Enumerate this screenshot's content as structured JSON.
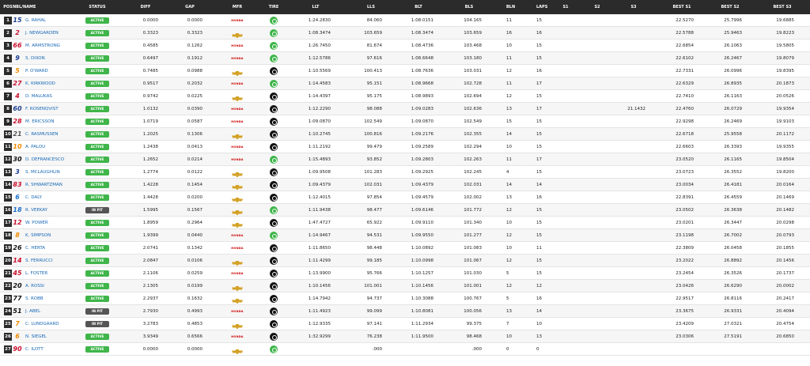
{
  "header": {
    "pos": "POS",
    "number_name": "NBL/NAME",
    "status": "STATUS",
    "diff": "DIFF",
    "gap": "GAP",
    "mfr": "MFR",
    "tire": "TIRE",
    "llt": "LLT",
    "lls": "LLS",
    "blt": "BLT",
    "bls": "BLS",
    "bln": "BLN",
    "laps": "LAPS",
    "s1": "S1",
    "s2": "S2",
    "s3": "S3",
    "best_s1": "BEST S1",
    "best_s2": "BEST S2",
    "best_s3": "BEST S3"
  },
  "colors": {
    "active": "#3fb54a",
    "in_pit": "#555555",
    "name_link": "#1769b5",
    "header_bg": "#2b2b2b"
  },
  "rows": [
    {
      "pos": "1",
      "num": "15",
      "num_color": "#1a3d8f",
      "name": "G. RAHAL",
      "status": "ACTIVE",
      "diff": "0.0000",
      "gap": "0.0000",
      "mfr": "honda",
      "tire": "green",
      "llt": "1:24.2830",
      "lls": "84.060",
      "blt": "1:08.0151",
      "bls": "104.165",
      "bln": "11",
      "laps": "15",
      "s1": "",
      "s2": "",
      "s3": "",
      "bs1": "22.5270",
      "bs2": "25.7996",
      "bs3": "19.6885"
    },
    {
      "pos": "2",
      "num": "2",
      "num_color": "#c8102e",
      "name": "J. NEWGARDEN",
      "status": "ACTIVE",
      "diff": "0.3323",
      "gap": "0.3323",
      "mfr": "chevy",
      "tire": "green",
      "llt": "1:08.3474",
      "lls": "103.659",
      "blt": "1:08.3474",
      "bls": "103.659",
      "bln": "16",
      "laps": "16",
      "s1": "",
      "s2": "",
      "s3": "",
      "bs1": "22.5788",
      "bs2": "25.9463",
      "bs3": "19.8223"
    },
    {
      "pos": "3",
      "num": "66",
      "num_color": "#c8102e",
      "name": "M. ARMSTRONG",
      "status": "ACTIVE",
      "diff": "0.4585",
      "gap": "0.1262",
      "mfr": "honda",
      "tire": "green",
      "llt": "1:26.7450",
      "lls": "81.674",
      "blt": "1:08.4736",
      "bls": "103.468",
      "bln": "10",
      "laps": "15",
      "s1": "",
      "s2": "",
      "s3": "",
      "bs1": "22.6854",
      "bs2": "26.1063",
      "bs3": "19.5805"
    },
    {
      "pos": "4",
      "num": "9",
      "num_color": "#1a3d8f",
      "name": "S. DIXON",
      "status": "ACTIVE",
      "diff": "0.6497",
      "gap": "0.1912",
      "mfr": "honda",
      "tire": "green",
      "llt": "1:12.5786",
      "lls": "97.616",
      "blt": "1:08.6648",
      "bls": "103.180",
      "bln": "11",
      "laps": "15",
      "s1": "",
      "s2": "",
      "s3": "",
      "bs1": "22.6102",
      "bs2": "26.2467",
      "bs3": "19.8079"
    },
    {
      "pos": "5",
      "num": "5",
      "num_color": "#f08a00",
      "name": "P. O'WARD",
      "status": "ACTIVE",
      "diff": "0.7485",
      "gap": "0.0988",
      "mfr": "chevy",
      "tire": "black",
      "llt": "1:10.5569",
      "lls": "100.413",
      "blt": "1:08.7636",
      "bls": "103.031",
      "bln": "12",
      "laps": "16",
      "s1": "",
      "s2": "",
      "s3": "",
      "bs1": "22.7331",
      "bs2": "26.0996",
      "bs3": "19.8395"
    },
    {
      "pos": "6",
      "num": "27",
      "num_color": "#c8102e",
      "name": "K. KIRKWOOD",
      "status": "ACTIVE",
      "diff": "0.9517",
      "gap": "0.2032",
      "mfr": "honda",
      "tire": "green",
      "llt": "1:14.4583",
      "lls": "95.151",
      "blt": "1:08.9668",
      "bls": "102.728",
      "bln": "11",
      "laps": "17",
      "s1": "",
      "s2": "",
      "s3": "",
      "bs1": "22.6329",
      "bs2": "26.8935",
      "bs3": "20.1873"
    },
    {
      "pos": "7",
      "num": "4",
      "num_color": "#c8102e",
      "name": "D. MALUKAS",
      "status": "ACTIVE",
      "diff": "0.9742",
      "gap": "0.0225",
      "mfr": "chevy",
      "tire": "black",
      "llt": "1:14.4397",
      "lls": "95.175",
      "blt": "1:08.9893",
      "bls": "102.694",
      "bln": "12",
      "laps": "15",
      "s1": "",
      "s2": "",
      "s3": "",
      "bs1": "22.7410",
      "bs2": "26.1163",
      "bs3": "20.0526"
    },
    {
      "pos": "8",
      "num": "60",
      "num_color": "#1a3d8f",
      "name": "F. ROSENQVIST",
      "status": "ACTIVE",
      "diff": "1.0132",
      "gap": "0.0390",
      "mfr": "honda",
      "tire": "black",
      "llt": "1:12.2290",
      "lls": "98.088",
      "blt": "1:09.0283",
      "bls": "102.636",
      "bln": "13",
      "laps": "17",
      "s1": "",
      "s2": "",
      "s3": "21.1432",
      "bs1": "22.4760",
      "bs2": "26.0729",
      "bs3": "19.9354"
    },
    {
      "pos": "9",
      "num": "28",
      "num_color": "#c8102e",
      "name": "M. ERICSSON",
      "status": "ACTIVE",
      "diff": "1.0719",
      "gap": "0.0587",
      "mfr": "honda",
      "tire": "black",
      "llt": "1:09.0870",
      "lls": "102.549",
      "blt": "1:09.0870",
      "bls": "102.549",
      "bln": "15",
      "laps": "15",
      "s1": "",
      "s2": "",
      "s3": "",
      "bs1": "22.9298",
      "bs2": "26.2469",
      "bs3": "19.9103"
    },
    {
      "pos": "10",
      "num": "21",
      "num_color": "#555555",
      "name": "C. RASMUSSEN",
      "status": "ACTIVE",
      "diff": "1.2025",
      "gap": "0.1306",
      "mfr": "chevy",
      "tire": "black",
      "llt": "1:10.2745",
      "lls": "100.816",
      "blt": "1:09.2176",
      "bls": "102.355",
      "bln": "14",
      "laps": "15",
      "s1": "",
      "s2": "",
      "s3": "",
      "bs1": "22.6718",
      "bs2": "25.9558",
      "bs3": "20.1172"
    },
    {
      "pos": "11",
      "num": "10",
      "num_color": "#f08a00",
      "name": "A. PALOU",
      "status": "ACTIVE",
      "diff": "1.2438",
      "gap": "0.0413",
      "mfr": "honda",
      "tire": "black",
      "llt": "1:11.2192",
      "lls": "99.479",
      "blt": "1:09.2589",
      "bls": "102.294",
      "bln": "10",
      "laps": "15",
      "s1": "",
      "s2": "",
      "s3": "",
      "bs1": "22.6603",
      "bs2": "26.3393",
      "bs3": "19.9355"
    },
    {
      "pos": "12",
      "num": "30",
      "num_color": "#111111",
      "name": "D. DEFRANCESCO",
      "status": "ACTIVE",
      "diff": "1.2652",
      "gap": "0.0214",
      "mfr": "honda",
      "tire": "green",
      "llt": "1:15.4893",
      "lls": "93.852",
      "blt": "1:09.2803",
      "bls": "102.263",
      "bln": "11",
      "laps": "17",
      "s1": "",
      "s2": "",
      "s3": "",
      "bs1": "23.0520",
      "bs2": "26.1165",
      "bs3": "19.8504"
    },
    {
      "pos": "13",
      "num": "3",
      "num_color": "#1a3d8f",
      "name": "S. MCLAUGHLIN",
      "status": "ACTIVE",
      "diff": "1.2774",
      "gap": "0.0122",
      "mfr": "chevy",
      "tire": "black",
      "llt": "1:09.9508",
      "lls": "101.283",
      "blt": "1:09.2925",
      "bls": "102.245",
      "bln": "4",
      "laps": "15",
      "s1": "",
      "s2": "",
      "s3": "",
      "bs1": "23.0723",
      "bs2": "26.3552",
      "bs3": "19.8200"
    },
    {
      "pos": "14",
      "num": "83",
      "num_color": "#c8102e",
      "name": "R. SHWARTZMAN",
      "status": "ACTIVE",
      "diff": "1.4228",
      "gap": "0.1454",
      "mfr": "chevy",
      "tire": "black",
      "llt": "1:09.4379",
      "lls": "102.031",
      "blt": "1:09.4379",
      "bls": "102.031",
      "bln": "14",
      "laps": "14",
      "s1": "",
      "s2": "",
      "s3": "",
      "bs1": "23.0034",
      "bs2": "26.4181",
      "bs3": "20.0164"
    },
    {
      "pos": "15",
      "num": "6",
      "num_color": "#1a6fd0",
      "name": "C. DALY",
      "status": "ACTIVE",
      "diff": "1.4428",
      "gap": "0.0200",
      "mfr": "chevy",
      "tire": "black",
      "llt": "1:12.4015",
      "lls": "97.854",
      "blt": "1:09.4579",
      "bls": "102.002",
      "bln": "13",
      "laps": "16",
      "s1": "",
      "s2": "",
      "s3": "",
      "bs1": "22.8391",
      "bs2": "26.4559",
      "bs3": "20.1469"
    },
    {
      "pos": "16",
      "num": "18",
      "num_color": "#1a6fd0",
      "name": "R. VEEKAY",
      "status": "IN PIT",
      "diff": "1.5995",
      "gap": "0.1567",
      "mfr": "chevy",
      "tire": "green",
      "llt": "1:11.9438",
      "lls": "98.477",
      "blt": "1:09.6146",
      "bls": "101.772",
      "bln": "12",
      "laps": "15",
      "s1": "",
      "s2": "",
      "s3": "",
      "bs1": "23.0502",
      "bs2": "26.3638",
      "bs3": "20.1482"
    },
    {
      "pos": "17",
      "num": "12",
      "num_color": "#c8102e",
      "name": "W. POWER",
      "status": "ACTIVE",
      "diff": "1.8959",
      "gap": "0.2964",
      "mfr": "chevy",
      "tire": "black",
      "llt": "1:47.4727",
      "lls": "65.922",
      "blt": "1:09.9110",
      "bls": "101.340",
      "bln": "10",
      "laps": "15",
      "s1": "",
      "s2": "",
      "s3": "",
      "bs1": "23.0201",
      "bs2": "26.3447",
      "bs3": "20.0298"
    },
    {
      "pos": "18",
      "num": "8",
      "num_color": "#f08a00",
      "name": "K. SIMPSON",
      "status": "ACTIVE",
      "diff": "1.9399",
      "gap": "0.0440",
      "mfr": "honda",
      "tire": "green",
      "llt": "1:14.9467",
      "lls": "94.531",
      "blt": "1:09.9550",
      "bls": "101.277",
      "bln": "12",
      "laps": "15",
      "s1": "",
      "s2": "",
      "s3": "",
      "bs1": "23.1198",
      "bs2": "26.7002",
      "bs3": "20.0793"
    },
    {
      "pos": "19",
      "num": "26",
      "num_color": "#111111",
      "name": "C. HERTA",
      "status": "ACTIVE",
      "diff": "2.0741",
      "gap": "0.1342",
      "mfr": "honda",
      "tire": "black",
      "llt": "1:11.8650",
      "lls": "98.448",
      "blt": "1:10.0892",
      "bls": "101.083",
      "bln": "10",
      "laps": "11",
      "s1": "",
      "s2": "",
      "s3": "",
      "bs1": "22.3809",
      "bs2": "26.0458",
      "bs3": "20.1855"
    },
    {
      "pos": "20",
      "num": "14",
      "num_color": "#c8102e",
      "name": "S. FERRUCCI",
      "status": "ACTIVE",
      "diff": "2.0847",
      "gap": "0.0106",
      "mfr": "chevy",
      "tire": "black",
      "llt": "1:11.4299",
      "lls": "99.185",
      "blt": "1:10.0998",
      "bls": "101.067",
      "bln": "12",
      "laps": "15",
      "s1": "",
      "s2": "",
      "s3": "",
      "bs1": "23.2022",
      "bs2": "26.8892",
      "bs3": "20.1456"
    },
    {
      "pos": "21",
      "num": "45",
      "num_color": "#c8102e",
      "name": "L. FOSTER",
      "status": "ACTIVE",
      "diff": "2.1106",
      "gap": "0.0259",
      "mfr": "honda",
      "tire": "black",
      "llt": "1:13.9900",
      "lls": "95.766",
      "blt": "1:10.1257",
      "bls": "101.030",
      "bln": "5",
      "laps": "15",
      "s1": "",
      "s2": "",
      "s3": "",
      "bs1": "23.2454",
      "bs2": "26.3526",
      "bs3": "20.1737"
    },
    {
      "pos": "22",
      "num": "20",
      "num_color": "#111111",
      "name": "A. ROSSI",
      "status": "ACTIVE",
      "diff": "2.1305",
      "gap": "0.0199",
      "mfr": "chevy",
      "tire": "black",
      "llt": "1:10.1456",
      "lls": "101.001",
      "blt": "1:10.1456",
      "bls": "101.001",
      "bln": "12",
      "laps": "12",
      "s1": "",
      "s2": "",
      "s3": "",
      "bs1": "23.0426",
      "bs2": "26.6290",
      "bs3": "20.0002"
    },
    {
      "pos": "23",
      "num": "77",
      "num_color": "#111111",
      "name": "S. ROBB",
      "status": "ACTIVE",
      "diff": "2.2937",
      "gap": "0.1632",
      "mfr": "chevy",
      "tire": "black",
      "llt": "1:14.7942",
      "lls": "94.737",
      "blt": "1:10.3088",
      "bls": "100.767",
      "bln": "5",
      "laps": "16",
      "s1": "",
      "s2": "",
      "s3": "",
      "bs1": "22.9517",
      "bs2": "26.8116",
      "bs3": "20.2417"
    },
    {
      "pos": "24",
      "num": "51",
      "num_color": "#111111",
      "name": "J. ABEL",
      "status": "IN PIT",
      "diff": "2.7930",
      "gap": "0.4993",
      "mfr": "honda",
      "tire": "black",
      "llt": "1:11.4923",
      "lls": "99.099",
      "blt": "1:10.8081",
      "bls": "100.056",
      "bln": "13",
      "laps": "14",
      "s1": "",
      "s2": "",
      "s3": "",
      "bs1": "23.3675",
      "bs2": "26.9331",
      "bs3": "20.4094"
    },
    {
      "pos": "25",
      "num": "7",
      "num_color": "#f08a00",
      "name": "C. LUNDGAARD",
      "status": "IN PIT",
      "diff": "3.2783",
      "gap": "0.4853",
      "mfr": "chevy",
      "tire": "black",
      "llt": "1:12.9335",
      "lls": "97.141",
      "blt": "1:11.2934",
      "bls": "99.375",
      "bln": "7",
      "laps": "10",
      "s1": "",
      "s2": "",
      "s3": "",
      "bs1": "23.4209",
      "bs2": "27.0321",
      "bs3": "20.4754"
    },
    {
      "pos": "26",
      "num": "6",
      "num_color": "#f08a00",
      "name": "N. SIEGEL",
      "status": "ACTIVE",
      "diff": "3.9349",
      "gap": "0.6566",
      "mfr": "honda",
      "tire": "black",
      "llt": "1:32.9299",
      "lls": "76.238",
      "blt": "1:11.9500",
      "bls": "98.468",
      "bln": "10",
      "laps": "13",
      "s1": "",
      "s2": "",
      "s3": "",
      "bs1": "23.0306",
      "bs2": "27.5191",
      "bs3": "20.6850"
    },
    {
      "pos": "27",
      "num": "90",
      "num_color": "#c8102e",
      "name": "C. ILOTT",
      "status": "ACTIVE",
      "diff": "0.0000",
      "gap": "0.0000",
      "mfr": "chevy",
      "tire": "green",
      "llt": "",
      "lls": ".000",
      "blt": "",
      "bls": ".000",
      "bln": "0",
      "laps": "0",
      "s1": "",
      "s2": "",
      "s3": "",
      "bs1": "",
      "bs2": "",
      "bs3": ""
    }
  ]
}
